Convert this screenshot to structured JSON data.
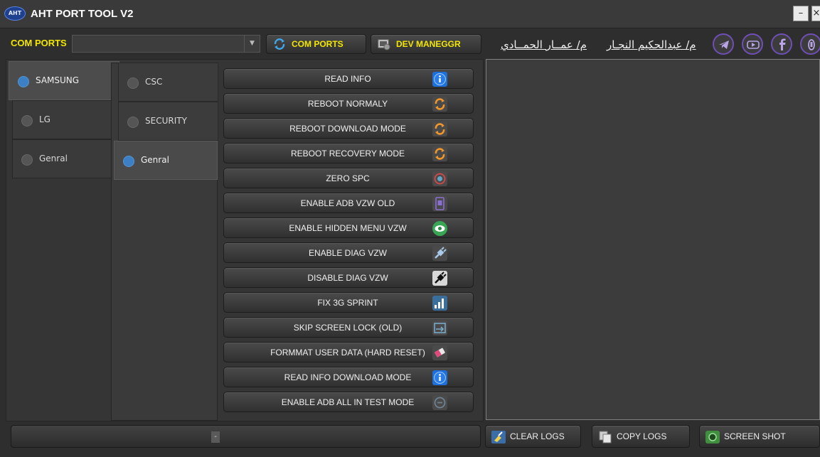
{
  "window": {
    "logo_text": "AHT",
    "title": "AHT PORT TOOL V2",
    "minimize_glyph": "–",
    "close_glyph": "×"
  },
  "toolbar": {
    "com_label": "COM PORTS",
    "com_select_value": "",
    "com_ports_button": "COM PORTS",
    "dev_manager_button": "DEV MANEGGR",
    "author_1": "م/ عمــار الحمــادي",
    "author_2": "م/ عبدالحكيم النجـار",
    "social_icons": [
      "telegram-icon",
      "youtube-icon",
      "facebook-icon",
      "messenger-icon"
    ]
  },
  "brand_tabs": [
    {
      "label": "SAMSUNG",
      "active": true
    },
    {
      "label": "LG",
      "active": false
    },
    {
      "label": "Genral",
      "active": false
    }
  ],
  "sub_tabs": [
    {
      "label": "CSC",
      "active": false
    },
    {
      "label": "SECURITY",
      "active": false
    },
    {
      "label": "Genral",
      "active": true
    }
  ],
  "functions": [
    {
      "label": "READ INFO",
      "icon": "info-icon",
      "color": "#1e6fd9"
    },
    {
      "label": "REBOOT NORMALY",
      "icon": "refresh-icon",
      "color": "#e08a1e"
    },
    {
      "label": "REBOOT DOWNLOAD MODE",
      "icon": "refresh-icon",
      "color": "#e08a1e"
    },
    {
      "label": "REBOOT RECOVERY MODE",
      "icon": "refresh-icon",
      "color": "#e08a1e"
    },
    {
      "label": "ZERO  SPC",
      "icon": "reset-icon",
      "color": "#c94a4a"
    },
    {
      "label": "ENABLE ADB VZW  OLD",
      "icon": "adb-icon",
      "color": "#7a5fc0"
    },
    {
      "label": "ENABLE HIDDEN MENU  VZW",
      "icon": "eye-icon",
      "color": "#3aa655"
    },
    {
      "label": "ENABLE  DIAG  VZW",
      "icon": "plug-icon",
      "color": "#8ab0d8"
    },
    {
      "label": "DISABLE  DIAG  VZW",
      "icon": "unplug-icon",
      "color": "#222222"
    },
    {
      "label": "FIX 3G SPRINT",
      "icon": "signal-icon",
      "color": "#4a9ee0"
    },
    {
      "label": "SKIP SCREEN LOCK (OLD)",
      "icon": "lock-skip-icon",
      "color": "#5a8aa8"
    },
    {
      "label": "FORMMAT USER  DATA  (HARD RESET)",
      "icon": "eraser-icon",
      "color": "#e04a7a"
    },
    {
      "label": "READ INFO DOWNLOAD MODE",
      "icon": "info-icon",
      "color": "#1e6fd9"
    },
    {
      "label": "ENABLE ADB ALL IN TEST MODE",
      "icon": "adb-test-icon",
      "color": "#607080"
    }
  ],
  "log": {
    "content": ""
  },
  "progress": {
    "value_text": "-",
    "percent": 0
  },
  "bottom_buttons": [
    {
      "label": "CLEAR LOGS",
      "icon": "broom-icon"
    },
    {
      "label": "COPY LOGS",
      "icon": "copy-icon"
    },
    {
      "label": "SCREEN SHOT",
      "icon": "camera-icon"
    }
  ]
}
